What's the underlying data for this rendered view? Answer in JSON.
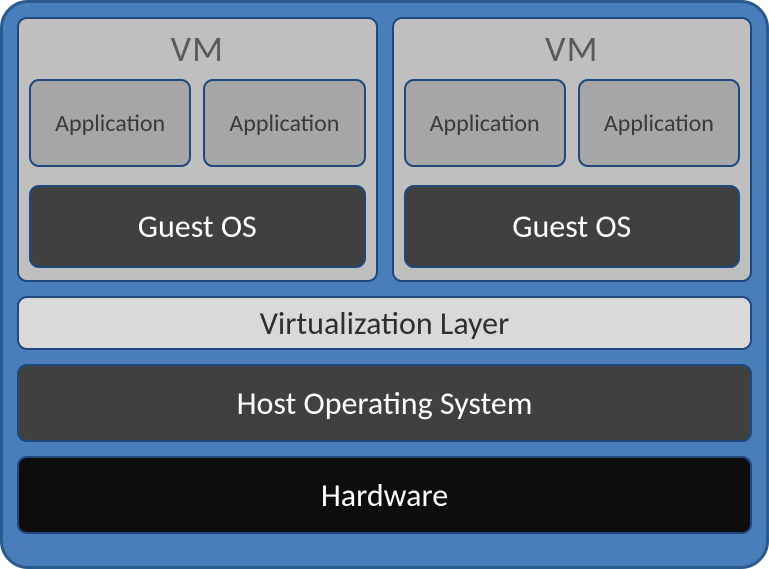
{
  "vms": [
    {
      "title": "VM",
      "applications": [
        "Application",
        "Application"
      ],
      "guest_os": "Guest OS"
    },
    {
      "title": "VM",
      "applications": [
        "Application",
        "Application"
      ],
      "guest_os": "Guest OS"
    }
  ],
  "layers": {
    "virtualization": "Virtualization Layer",
    "host_os": "Host Operating System",
    "hardware": "Hardware"
  }
}
